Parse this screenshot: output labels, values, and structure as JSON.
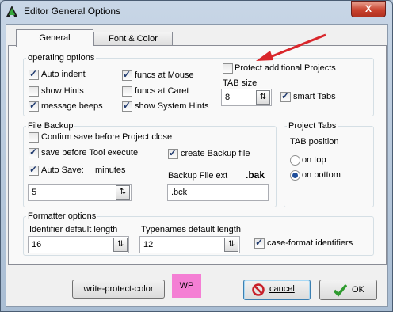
{
  "window": {
    "title": "Editor General Options",
    "close_symbol": "X"
  },
  "tabs": [
    {
      "label": "General"
    },
    {
      "label": "Font & Color"
    }
  ],
  "operating": {
    "legend": "operating options",
    "auto_indent": {
      "label": "Auto indent",
      "checked": true
    },
    "show_hints": {
      "label": "show Hints",
      "checked": false
    },
    "message_beeps": {
      "label": "message beeps",
      "checked": true
    },
    "funcs_mouse": {
      "label": "funcs at Mouse",
      "checked": true
    },
    "funcs_caret": {
      "label": "funcs at Caret",
      "checked": false
    },
    "show_system_hints": {
      "label": "show System Hints",
      "checked": true
    },
    "protect_projects": {
      "label": "Protect additional Projects",
      "checked": false
    },
    "tab_size_label": "TAB size",
    "tab_size_value": "8",
    "smart_tabs": {
      "label": "smart Tabs",
      "checked": true
    }
  },
  "backup": {
    "legend": "File Backup",
    "confirm_save": {
      "label": "Confirm save before Project close",
      "checked": false
    },
    "save_before_tool": {
      "label": "save before Tool execute",
      "checked": true
    },
    "create_backup": {
      "label": "create Backup file",
      "checked": true
    },
    "auto_save": {
      "label": "Auto Save:",
      "checked": true
    },
    "minutes_label": "minutes",
    "minutes_value": "5",
    "ext_label": "Backup File ext",
    "ext_example": ".bak",
    "ext_value": ".bck"
  },
  "project_tabs": {
    "legend": "Project Tabs",
    "position_label": "TAB position",
    "on_top": {
      "label": "on top",
      "selected": false
    },
    "on_bottom": {
      "label": "on bottom",
      "selected": true
    }
  },
  "formatter": {
    "legend": "Formatter options",
    "identifier_label": "Identifier default length",
    "identifier_value": "16",
    "typenames_label": "Typenames default length",
    "typenames_value": "12",
    "case_format": {
      "label": "case-format identifiers",
      "checked": true
    }
  },
  "buttons": {
    "write_protect": "write-protect-color",
    "wp_swatch": "WP",
    "cancel": "cancel",
    "ok": "OK"
  },
  "colors": {
    "annotation_arrow": "#d9262b",
    "wp_swatch": "#f47fd4",
    "ok_check": "#2e9b2e",
    "cancel_icon": "#c8202a"
  }
}
